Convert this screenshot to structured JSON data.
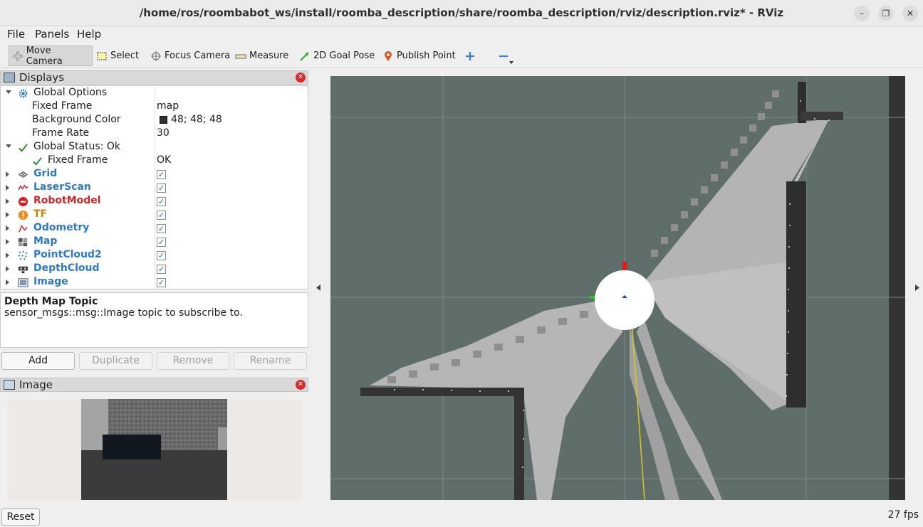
{
  "window": {
    "title": "/home/ros/roombabot_ws/install/roomba_description/share/roomba_description/rviz/description.rviz* - RViz"
  },
  "menu": {
    "file": "File",
    "panels": "Panels",
    "help": "Help"
  },
  "toolbar": {
    "move_camera": "Move Camera",
    "select": "Select",
    "focus_camera": "Focus Camera",
    "measure": "Measure",
    "goal_pose": "2D Goal Pose",
    "publish_point": "Publish Point"
  },
  "displays_panel": {
    "title": "Displays",
    "global_options": {
      "label": "Global Options",
      "fixed_frame_label": "Fixed Frame",
      "fixed_frame_value": "map",
      "background_color_label": "Background Color",
      "background_color_value": "48; 48; 48",
      "background_color_swatch": "#303030",
      "frame_rate_label": "Frame Rate",
      "frame_rate_value": "30"
    },
    "global_status": {
      "label": "Global Status: Ok",
      "fixed_frame_label": "Fixed Frame",
      "fixed_frame_value": "OK"
    },
    "displays": [
      {
        "name": "Grid",
        "color": "#2e79c4",
        "icon": "grid-icon",
        "checked": true
      },
      {
        "name": "LaserScan",
        "color": "#2e79c4",
        "icon": "laserscan-icon",
        "checked": true
      },
      {
        "name": "RobotModel",
        "color": "#c62828",
        "icon": "robotmodel-error-icon",
        "checked": true
      },
      {
        "name": "TF",
        "color": "#c8860a",
        "icon": "tf-warning-icon",
        "checked": true
      },
      {
        "name": "Odometry",
        "color": "#2e79c4",
        "icon": "odometry-icon",
        "checked": true
      },
      {
        "name": "Map",
        "color": "#2e79c4",
        "icon": "map-icon",
        "checked": true
      },
      {
        "name": "PointCloud2",
        "color": "#2e79c4",
        "icon": "pointcloud-icon",
        "checked": true
      },
      {
        "name": "DepthCloud",
        "color": "#2e79c4",
        "icon": "depthcloud-icon",
        "checked": true
      },
      {
        "name": "Image",
        "color": "#2e79c4",
        "icon": "image-icon",
        "checked": true
      }
    ]
  },
  "description": {
    "title": "Depth Map Topic",
    "text": "sensor_msgs::msg::Image topic to subscribe to."
  },
  "buttons": {
    "add": "Add",
    "duplicate": "Duplicate",
    "remove": "Remove",
    "rename": "Rename"
  },
  "image_panel": {
    "title": "Image"
  },
  "status": {
    "reset": "Reset",
    "fps": "27 fps"
  }
}
